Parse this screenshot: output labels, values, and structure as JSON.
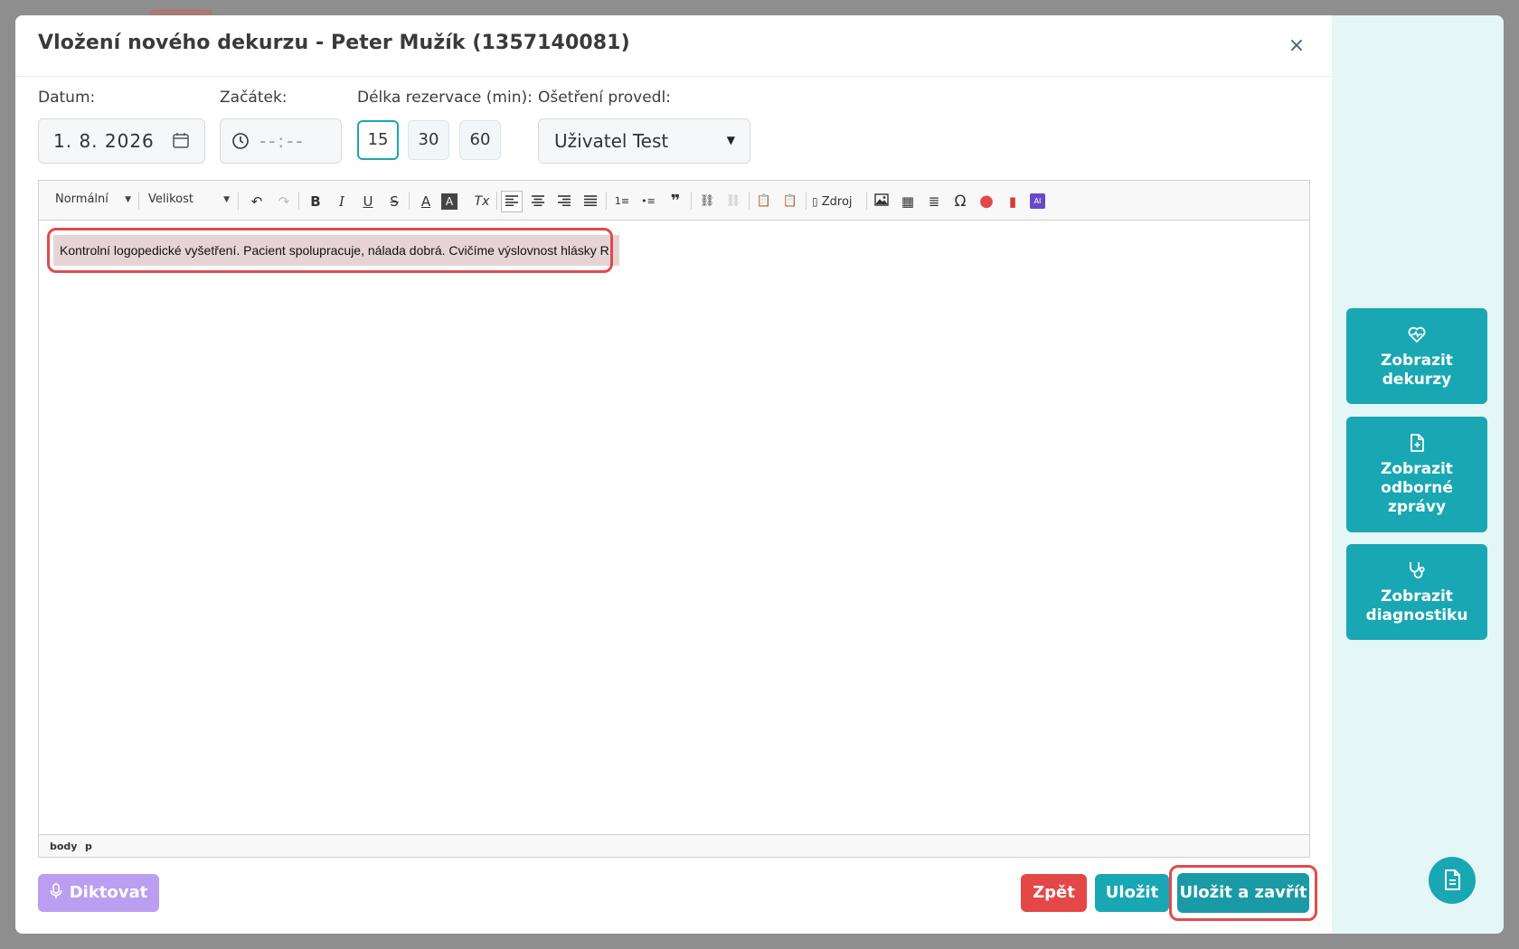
{
  "modal": {
    "title": "Vložení nového dekurzu - Peter Mužík (1357140081)",
    "close_label": "×"
  },
  "form": {
    "date_label": "Datum:",
    "date_value": "1. 8. 2026",
    "start_label": "Začátek:",
    "start_placeholder": "--:--",
    "duration_label": "Délka rezervace (min):",
    "durations": [
      "15",
      "30",
      "60"
    ],
    "duration_selected": "15",
    "performed_by_label": "Ošetření provedl:",
    "performed_by_value": "Uživatel Test"
  },
  "editor": {
    "format_combo": "Normální",
    "size_combo": "Velikost",
    "source_label": "Zdroj",
    "content_text": "Kontrolní logopedické vyšetření. Pacient spolupracuje, nálada dobrá. Cvičíme výslovnost hlásky R.",
    "path": [
      "body",
      "p"
    ],
    "icons": {
      "undo": "↶",
      "redo": "↷",
      "bold": "B",
      "italic": "I",
      "underline": "U",
      "strike": "S",
      "text_color": "A",
      "bg_color": "A",
      "remove_format": "Tx",
      "ordered_list": "1≡",
      "bullet_list": "•≡",
      "blockquote": "❞",
      "link": "⛓",
      "unlink": "⛓",
      "paste_text": "📋",
      "paste_word": "📋",
      "image": "🖼",
      "table": "▦",
      "hr": "≣",
      "omega": "Ω",
      "comment": "●",
      "pdf": "▮",
      "ai": "AI"
    }
  },
  "actions": {
    "dictate": "Diktovat",
    "back": "Zpět",
    "save": "Uložit",
    "save_close": "Uložit a zavřít"
  },
  "side": {
    "show_records": "Zobrazit dekurzy",
    "show_reports": "Zobrazit odborné zprávy",
    "show_diagnostics": "Zobrazit diagnostiku"
  },
  "colors": {
    "accent": "#1aa7b4",
    "danger": "#e44747",
    "dictate": "#b99ef2",
    "highlight_outline": "#e04b4b"
  }
}
